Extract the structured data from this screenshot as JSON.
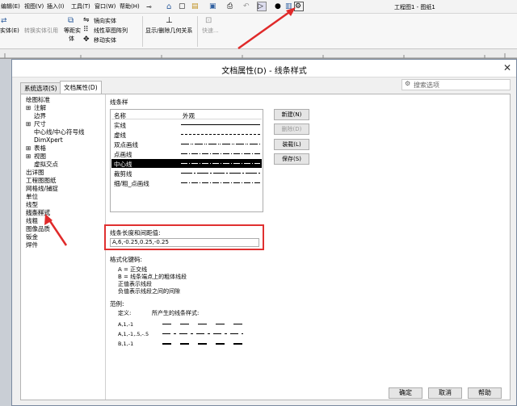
{
  "menu": [
    "编辑(E)",
    "视图(V)",
    "插入(I)",
    "工具(T)",
    "窗口(W)",
    "帮助(H)"
  ],
  "doc_title": "工程图1 - 图纸1",
  "ribbon": {
    "left_label": "转换实体引用",
    "left_label2": "实体(E)",
    "btn_equal_l1": "等距实",
    "btn_equal_l2": "体",
    "mirror": "镜向实体",
    "linear_pattern": "线性草图阵列",
    "move": "移动实体",
    "show_relations": "显示/删除几何关系",
    "quick": "快速..."
  },
  "dialog": {
    "title": "文档属性(D) - 线条样式",
    "close": "✕",
    "tab_system": "系统选项(S)",
    "tab_document": "文档属性(D)",
    "search_placeholder": "搜索选项",
    "tree": [
      "绘图标准",
      "注解",
      "边界",
      "尺寸",
      "中心线/中心符号线",
      "DimXpert",
      "表格",
      "视图",
      "虚拟交点",
      "出详图",
      "工程图图纸",
      "网格线/捕捉",
      "单位",
      "线型",
      "线条样式",
      "线粗",
      "图像品质",
      "钣金",
      "焊件"
    ],
    "section_title": "线条样",
    "col_name": "名称",
    "col_appearance": "外观",
    "styles": [
      "实线",
      "虚线",
      "双点画线",
      "点画线",
      "中心线",
      "裁剪线",
      "细/粗_点画线"
    ],
    "selected_style": "中心线",
    "btn_new": "新建(N)",
    "btn_delete": "删除(D)",
    "btn_load": "装载(L)",
    "btn_save": "保存(S)",
    "pattern_label": "线条长度和间距值:",
    "pattern_value": "A,6,-0.25,0.25,-0.25",
    "format_title": "格式化键码:",
    "format_lines": [
      "A = 正交线",
      "B = 线条端点上的粗体线段",
      "正值表示线段",
      "负值表示线段之间的间隙"
    ],
    "example_title": "范例:",
    "example_def": "定义:",
    "example_result": "所产生的线条样式:",
    "example_codes": [
      "A,1,-1",
      "A,1,-1,.5,-.5",
      "B,1,-1"
    ],
    "btn_ok": "确定",
    "btn_cancel": "取消",
    "btn_help": "帮助"
  },
  "colors": {
    "accent_red": "#e02a2a",
    "selection": "#000000"
  }
}
